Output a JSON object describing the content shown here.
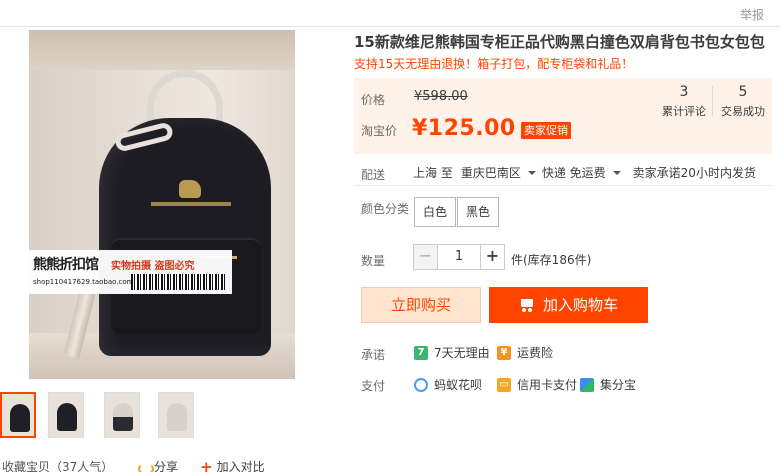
{
  "header": {
    "report_label": "举报"
  },
  "gallery": {
    "watermark": {
      "shop_name": "熊熊折扣馆",
      "tag": "实物拍摄 盗图必究",
      "url": "shop110417629.taobao.com"
    },
    "thumbnails": [
      {
        "label": "black",
        "active": true
      },
      {
        "label": "black",
        "active": false
      },
      {
        "label": "white",
        "active": false
      },
      {
        "label": "white",
        "active": false
      }
    ]
  },
  "bottom_bar": {
    "favorite": "收藏宝贝（37人气）",
    "share": "分享",
    "compare": "加入对比"
  },
  "product": {
    "title": "15新款维尼熊韩国专柜正品代购黑白撞色双肩背包书包女包包",
    "subtitle": "支持15天无理由退换！箱子打包，配专柜袋和礼品！"
  },
  "price": {
    "price_label": "价格",
    "original": "¥598.00",
    "taobao_label": "淘宝价",
    "taobao_price": "¥125.00",
    "promo": "卖家促销",
    "stats": [
      {
        "num": "3",
        "text": "累计评论"
      },
      {
        "num": "5",
        "text": "交易成功"
      }
    ]
  },
  "shipping": {
    "label": "配送",
    "from": "上海 至",
    "to": "重庆巴南区",
    "method": "快递 免运费",
    "promise": "卖家承诺20小时内发货"
  },
  "color": {
    "label": "颜色分类",
    "options": [
      "白色",
      "黑色"
    ]
  },
  "quantity": {
    "label": "数量",
    "minus": "−",
    "value": "1",
    "plus": "+",
    "stock": "件(库存186件)"
  },
  "actions": {
    "buy_now": "立即购买",
    "add_cart": "加入购物车"
  },
  "promise": {
    "label": "承诺",
    "items": [
      {
        "icon": "seven-day-icon",
        "glyph": "7",
        "text": "7天无理由"
      },
      {
        "icon": "shipping-insurance-icon",
        "glyph": "¥",
        "text": "运费险"
      }
    ]
  },
  "payment": {
    "label": "支付",
    "items": [
      {
        "icon": "ant-huabei-icon",
        "glyph": "",
        "text": "蚂蚁花呗"
      },
      {
        "icon": "credit-card-icon",
        "glyph": "▭",
        "text": "信用卡支付"
      },
      {
        "icon": "jifenbao-icon",
        "glyph": "",
        "text": "集分宝"
      }
    ]
  },
  "colors": {
    "accent": "#ff4400",
    "price_bg": "#fff2e8",
    "buy_bg": "#ffe4d0"
  }
}
